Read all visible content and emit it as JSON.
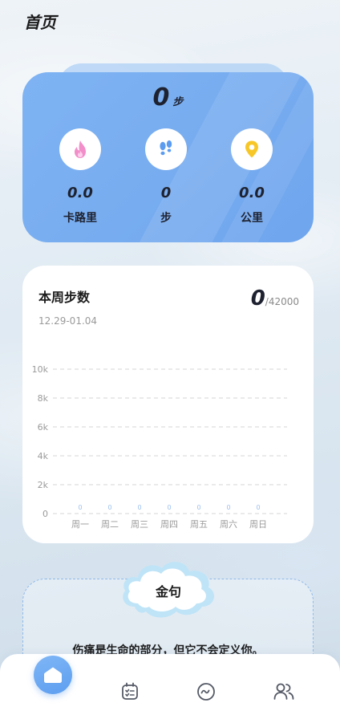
{
  "header": {
    "title": "首页"
  },
  "today": {
    "steps": "0",
    "steps_unit": "步",
    "stats": [
      {
        "value": "0.0",
        "label": "卡路里",
        "icon": "flame-icon"
      },
      {
        "value": "0",
        "label": "步",
        "icon": "footprints-icon"
      },
      {
        "value": "0.0",
        "label": "公里",
        "icon": "location-pin-icon"
      }
    ]
  },
  "week": {
    "title": "本周步数",
    "range": "12.29-01.04",
    "total": "0",
    "goal": "/42000"
  },
  "chart_data": {
    "type": "bar",
    "categories": [
      "周一",
      "周二",
      "周三",
      "周四",
      "周五",
      "周六",
      "周日"
    ],
    "values": [
      0,
      0,
      0,
      0,
      0,
      0,
      0
    ],
    "value_labels": [
      "0",
      "0",
      "0",
      "0",
      "0",
      "0",
      "0"
    ],
    "ylim": [
      0,
      10000
    ],
    "yticks": [
      0,
      2000,
      4000,
      6000,
      8000,
      10000
    ],
    "ytick_labels": [
      "0",
      "2k",
      "4k",
      "6k",
      "8k",
      "10k"
    ],
    "grid": true,
    "title": "",
    "xlabel": "",
    "ylabel": "",
    "colors": {
      "bar": "#7fb1f2",
      "grid": "#d6d6d6",
      "label": "#9bbfee",
      "tick": "#9a9a9a"
    }
  },
  "quote": {
    "label": "金句",
    "text": "伤痛是生命的部分，但它不会定义你。"
  },
  "tabs": [
    {
      "name": "home",
      "icon": "home-icon",
      "active": true
    },
    {
      "name": "checklist",
      "icon": "checklist-icon",
      "active": false
    },
    {
      "name": "activity",
      "icon": "activity-icon",
      "active": false
    },
    {
      "name": "friends",
      "icon": "people-icon",
      "active": false
    }
  ],
  "colors": {
    "accent": "#6ea5ed",
    "card": "#ffffff",
    "text": "#1e2230"
  }
}
